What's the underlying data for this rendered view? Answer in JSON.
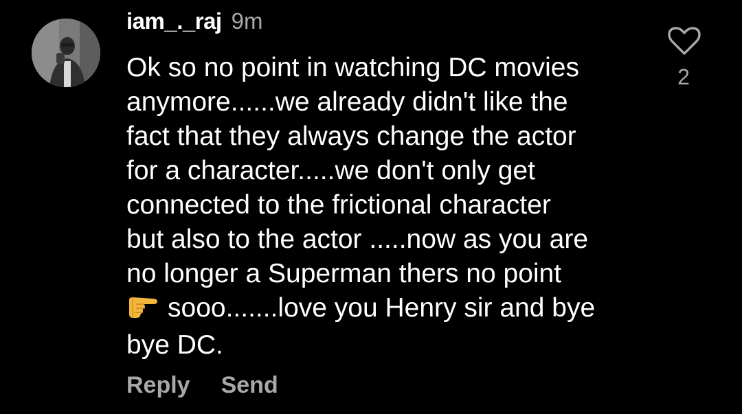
{
  "comment": {
    "username": "iam_._raj",
    "timestamp": "9m",
    "text_lines": [
      "Ok so no point in watching DC movies",
      "anymore......we already didn't like the",
      "fact that they always change the actor",
      "for a character.....we don't only get",
      "connected to the frictional character",
      "but also to the actor .....now as you are",
      "no longer a Superman thers no point",
      "sooo.......love you Henry sir and bye",
      "bye DC."
    ],
    "emoji_icon": "backhand-index-pointing-right-icon",
    "like_count": "2",
    "actions": {
      "reply_label": "Reply",
      "send_label": "Send"
    }
  },
  "colors": {
    "background": "#000000",
    "text_primary": "#ffffff",
    "text_secondary": "#a8a8a8"
  }
}
